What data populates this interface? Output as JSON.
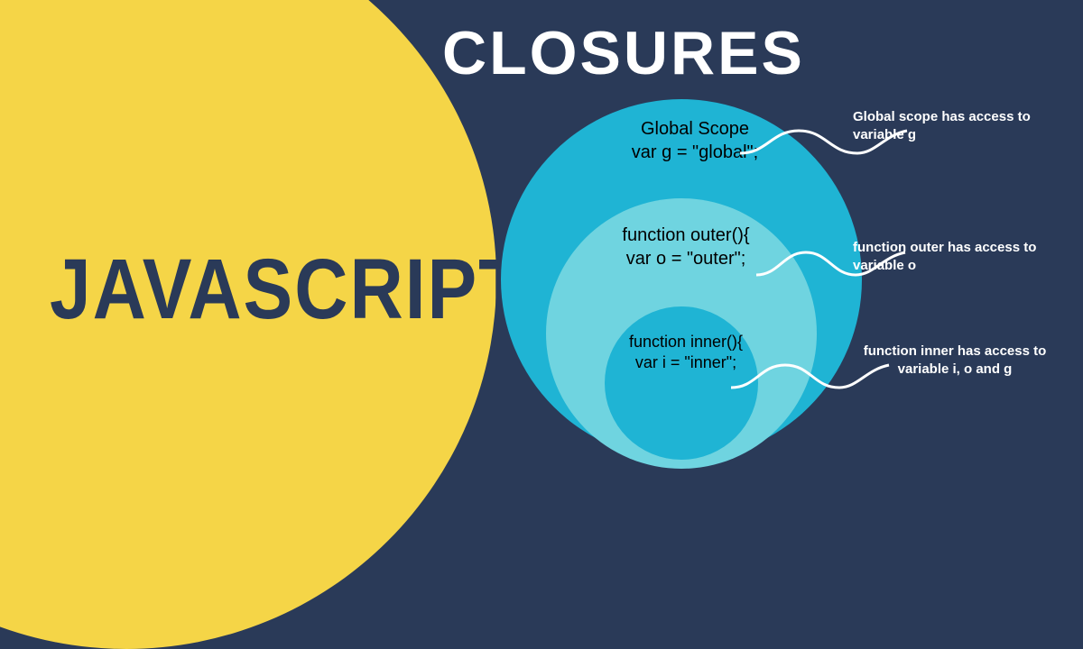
{
  "left_title": "JAVASCRIPT",
  "main_title": "CLOSURES",
  "scopes": {
    "global": {
      "line1": "Global Scope",
      "line2": "var g = \"global\";"
    },
    "outer": {
      "line1": "function outer(){",
      "line2": "var o = \"outer\";"
    },
    "inner": {
      "line1": "function inner(){",
      "line2": "var i = \"inner\";"
    }
  },
  "annotations": {
    "global": "Global scope has access to variable g",
    "outer": "function outer has access to variable o",
    "inner": "function inner has access to variable i, o and g"
  }
}
